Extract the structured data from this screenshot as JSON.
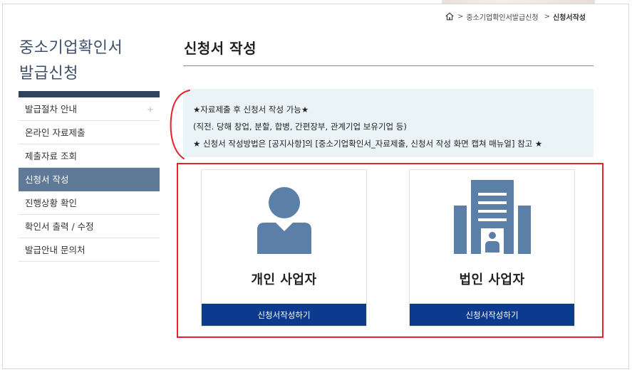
{
  "breadcrumb": {
    "home_icon": "home-icon",
    "sep": ">",
    "items": [
      "중소기업확인서발급신청",
      "신청서작성"
    ]
  },
  "sidebar": {
    "title_line1": "중소기업확인서",
    "title_line2": "발급신청",
    "items": [
      {
        "label": "발급절차 안내",
        "expand": "+"
      },
      {
        "label": "온라인 자료제출"
      },
      {
        "label": "제출자료 조회"
      },
      {
        "label": "신청서 작성"
      },
      {
        "label": "진행상황 확인"
      },
      {
        "label": "확인서 출력 / 수정"
      },
      {
        "label": "발급안내 문의처"
      }
    ]
  },
  "main": {
    "title": "신청서 작성",
    "notice": {
      "line1": "★자료제출 후 신청서 작성 가능★",
      "line2": "(직전. 당해 창업, 분할, 합병, 간편장부, 관계기업 보유기업 등)",
      "line3": "★ 신청서 작성방법은 [공지사항]의 [중소기업확인서_자료제출, 신청서 작성 화면 캡쳐 매뉴얼] 참고 ★"
    },
    "cards": [
      {
        "label": "개인 사업자",
        "button": "신청서작성하기",
        "icon": "person-icon"
      },
      {
        "label": "법인 사업자",
        "button": "신청서작성하기",
        "icon": "building-icon"
      }
    ]
  },
  "colors": {
    "accent_blue": "#0b3a8e",
    "sidebar_active": "#5f7a96",
    "sidebar_bar": "#2f4361",
    "icon_blue": "#5b7fa6",
    "highlight_red": "#e8202a",
    "notice_bg": "#eaf3f6"
  }
}
